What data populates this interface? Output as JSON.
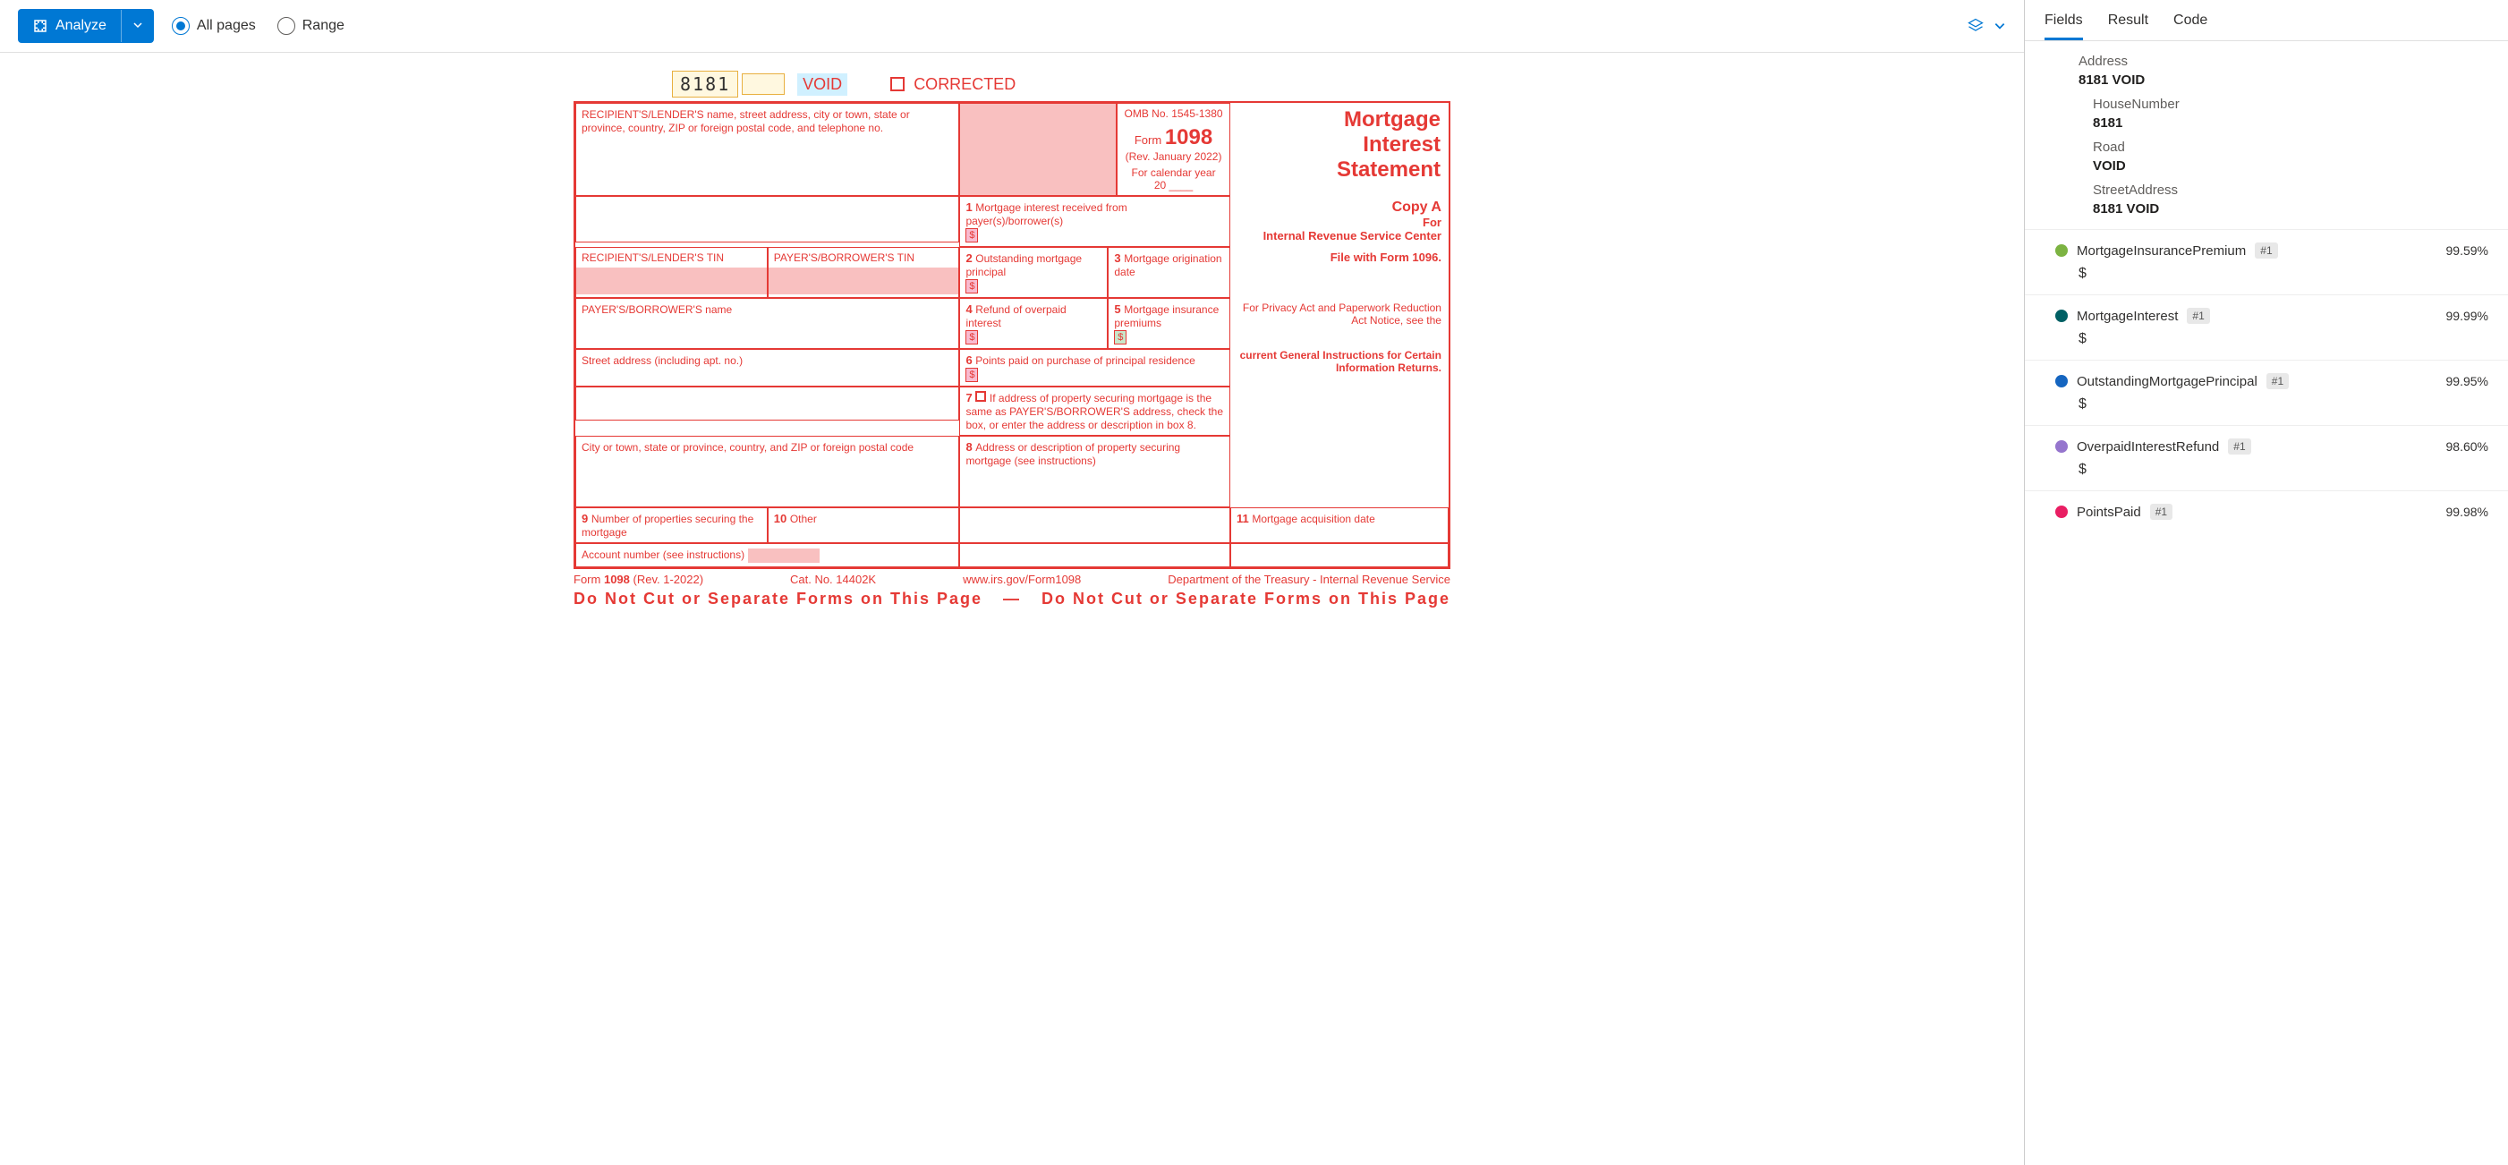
{
  "toolbar": {
    "analyze_label": "Analyze",
    "all_pages": "All pages",
    "range": "Range"
  },
  "form": {
    "code": "8181",
    "void": "VOID",
    "corrected": "CORRECTED",
    "recipient_label": "RECIPIENT'S/LENDER'S name, street address, city or town, state or province, country, ZIP or foreign postal code, and telephone no.",
    "omb": "OMB No. 1545-1380",
    "form_word": "Form",
    "form_no": "1098",
    "rev": "(Rev. January 2022)",
    "cal_year": "For calendar year",
    "year20": "20",
    "title1": "Mortgage",
    "title2": "Interest",
    "title3": "Statement",
    "box1": "Mortgage interest received from payer(s)/borrower(s)",
    "recip_tin": "RECIPIENT'S/LENDER'S TIN",
    "payer_tin": "PAYER'S/BORROWER'S TIN",
    "box2": "Outstanding mortgage principal",
    "box3": "Mortgage origination date",
    "box4": "Refund of overpaid interest",
    "box5": "Mortgage insurance premiums",
    "box6": "Points paid on purchase of principal residence",
    "payer_name": "PAYER'S/BORROWER'S name",
    "street": "Street address (including apt. no.)",
    "box7": "If address of property securing mortgage is the same as PAYER'S/BORROWER'S address, check the box, or enter the address or description in box 8.",
    "city": "City or town, state or province, country, and ZIP or foreign postal code",
    "box8": "Address or description of property securing mortgage (see instructions)",
    "box9": "Number of properties securing the mortgage",
    "box10": "Other",
    "box11": "Mortgage acquisition date",
    "acct": "Account number (see instructions)",
    "copy_a": "Copy A",
    "for": "For",
    "irs_center": "Internal Revenue Service Center",
    "file_with": "File with Form 1096.",
    "privacy": "For Privacy Act and Paperwork Reduction Act Notice, see the",
    "privacy2": "current General Instructions for Certain Information Returns.",
    "footer_form": "Form",
    "footer_1098": "1098",
    "footer_rev": "(Rev. 1-2022)",
    "footer_cat": "Cat. No. 14402K",
    "footer_url": "www.irs.gov/Form1098",
    "footer_dept": "Department of the Treasury - Internal Revenue Service",
    "warn1": "Do  Not  Cut  or  Separate  Forms  on  This  Page",
    "warn_dash": "—",
    "warn2": "Do  Not  Cut  or  Separate  Forms  on  This  Page"
  },
  "tabs": {
    "fields": "Fields",
    "result": "Result",
    "code": "Code"
  },
  "address": {
    "label": "Address",
    "value": "8181 VOID",
    "house_label": "HouseNumber",
    "house_val": "8181",
    "road_label": "Road",
    "road_val": "VOID",
    "street_label": "StreetAddress",
    "street_val": "8181 VOID"
  },
  "fields": [
    {
      "name": "MortgageInsurancePremium",
      "badge": "#1",
      "conf": "99.59%",
      "val": "$",
      "color": "#7cb342"
    },
    {
      "name": "MortgageInterest",
      "badge": "#1",
      "conf": "99.99%",
      "val": "$",
      "color": "#006064"
    },
    {
      "name": "OutstandingMortgagePrincipal",
      "badge": "#1",
      "conf": "99.95%",
      "val": "$",
      "color": "#1565c0"
    },
    {
      "name": "OverpaidInterestRefund",
      "badge": "#1",
      "conf": "98.60%",
      "val": "$",
      "color": "#9575cd"
    },
    {
      "name": "PointsPaid",
      "badge": "#1",
      "conf": "99.98%",
      "val": "",
      "color": "#e91e63"
    }
  ]
}
